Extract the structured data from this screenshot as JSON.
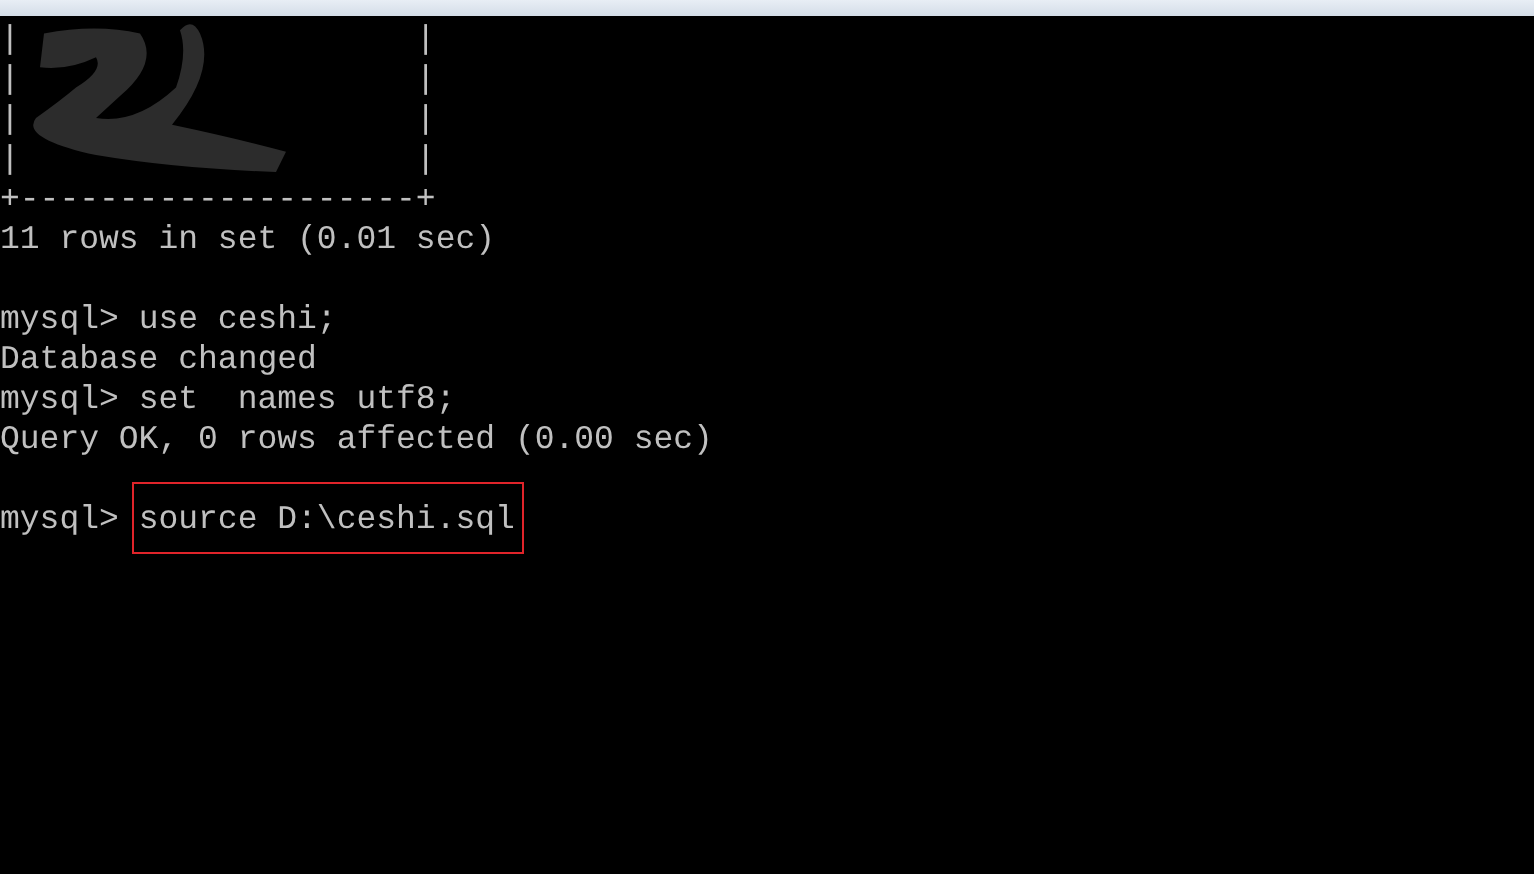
{
  "terminal": {
    "lines": [
      {
        "kind": "text",
        "text": "|                    |"
      },
      {
        "kind": "text",
        "text": "|                    |"
      },
      {
        "kind": "text",
        "text": "|                    |"
      },
      {
        "kind": "text",
        "text": "|                    |"
      },
      {
        "kind": "text",
        "text": "+--------------------+"
      },
      {
        "kind": "text",
        "text": "11 rows in set (0.01 sec)"
      },
      {
        "kind": "blank"
      },
      {
        "kind": "prompt",
        "prompt": "mysql>",
        "command": "use ceshi;",
        "highlighted": false
      },
      {
        "kind": "text",
        "text": "Database changed"
      },
      {
        "kind": "prompt",
        "prompt": "mysql>",
        "command": "set  names utf8;",
        "highlighted": false
      },
      {
        "kind": "text",
        "text": "Query OK, 0 rows affected (0.00 sec)"
      },
      {
        "kind": "blank"
      },
      {
        "kind": "prompt",
        "prompt": "mysql>",
        "command": "source D:\\ceshi.sql",
        "highlighted": true
      }
    ]
  }
}
